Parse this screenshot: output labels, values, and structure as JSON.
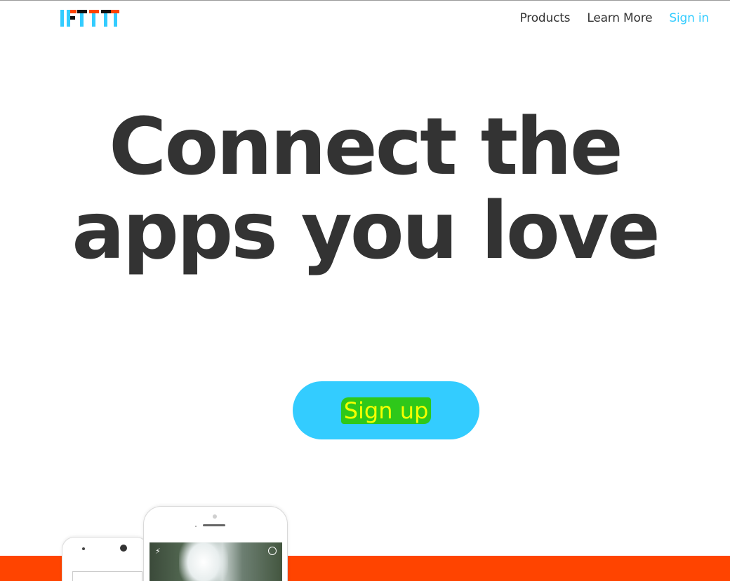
{
  "brand": {
    "logo_text": "IFTTT",
    "colors": {
      "accent": "#33ccff",
      "orange": "#ff4400",
      "text": "#333333",
      "highlight_bg": "#2ec81a",
      "highlight_text": "#f5ff00"
    }
  },
  "nav": {
    "products_label": "Products",
    "learn_more_label": "Learn More",
    "sign_in_label": "Sign in"
  },
  "hero": {
    "line1": "Connect the",
    "line2": "apps you love",
    "cta_label": "Sign up"
  },
  "devices": {
    "front_phone_icons": [
      "flash-icon",
      "camera-flip-icon"
    ]
  }
}
